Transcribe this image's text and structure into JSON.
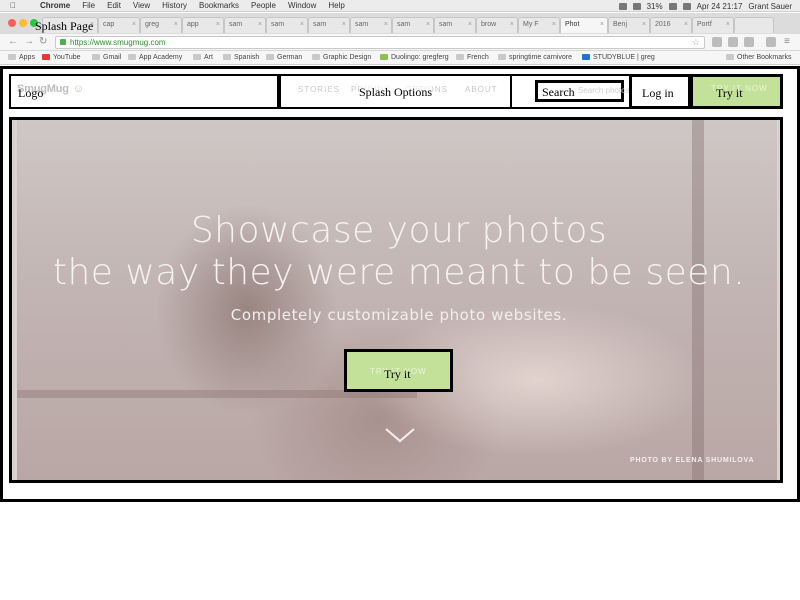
{
  "menubar": {
    "app": "Chrome",
    "items": [
      "File",
      "Edit",
      "View",
      "History",
      "Bookmarks",
      "People",
      "Window",
      "Help"
    ],
    "battery": "31%",
    "datetime": "Apr 24  21:17",
    "user": "Grant Sauer"
  },
  "tabs": [
    {
      "label": "Splash Page"
    },
    {
      "label": "cap"
    },
    {
      "label": "greg"
    },
    {
      "label": "app"
    },
    {
      "label": "sam"
    },
    {
      "label": "sam"
    },
    {
      "label": "sam"
    },
    {
      "label": "sam"
    },
    {
      "label": "sam"
    },
    {
      "label": "sam"
    },
    {
      "label": "brow"
    },
    {
      "label": "My F"
    },
    {
      "label": "Phot"
    },
    {
      "label": "Benj"
    },
    {
      "label": "2016"
    },
    {
      "label": "Portf"
    }
  ],
  "omnibox": {
    "url": "https://www.smugmug.com"
  },
  "bookmarks": [
    {
      "label": "Apps"
    },
    {
      "label": "YouTube"
    },
    {
      "label": "Gmail"
    },
    {
      "label": "App Academy"
    },
    {
      "label": "Art"
    },
    {
      "label": "Spanish"
    },
    {
      "label": "German"
    },
    {
      "label": "Graphic Design"
    },
    {
      "label": "Duolingo: gregferg"
    },
    {
      "label": "French"
    },
    {
      "label": "springtime carnivore"
    },
    {
      "label": "STUDYBLUE | greg"
    },
    {
      "label": "Other Bookmarks"
    }
  ],
  "wireframe": {
    "page_label": "Splash Page",
    "logo_label": "Logo",
    "options_label": "Splash Options",
    "search_label": "Search",
    "login_label": "Log in",
    "try_label": "Try it",
    "hero_try_label": "Try it"
  },
  "site": {
    "logo_text": "SmugMug",
    "nav_links": [
      "STORIES",
      "PRICING",
      "OPTIONS",
      "ABOUT"
    ],
    "search_placeholder": "Search photos...",
    "login": "LOG IN",
    "try_now": "TRY IT NOW",
    "headline_line1": "Showcase your photos",
    "headline_line2": "the way they were meant to be seen.",
    "subheadline": "Completely customizable photo websites.",
    "hero_cta": "TRY IT NOW",
    "credit": "PHOTO BY ELENA SHUMILOVA"
  },
  "colors": {
    "accent_green": "#c4e19a",
    "wire_border": "#000000"
  }
}
